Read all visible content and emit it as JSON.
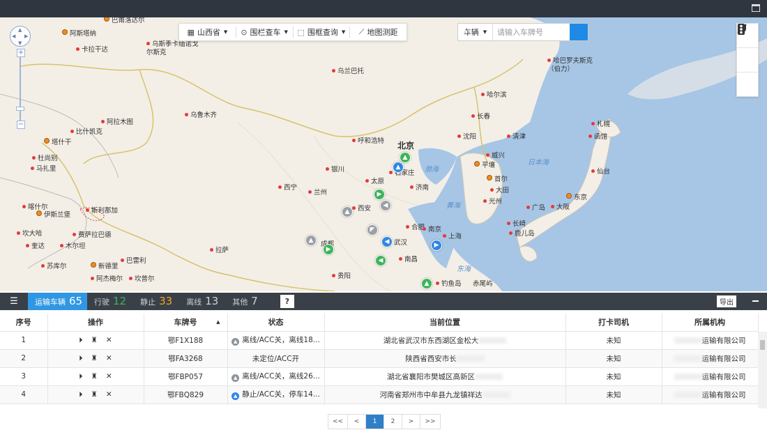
{
  "map": {
    "toolbar": {
      "region": "山西省",
      "fence_search": "围栏查车",
      "frame_search": "围框查询",
      "measure": "地图测距"
    },
    "search": {
      "type": "车辆",
      "placeholder": "请输入车牌号"
    },
    "labels": {
      "beijing": "北京",
      "hohhot": "呼和浩特",
      "shijiazhuang": "石家庄",
      "taiyuan": "太原",
      "jinan": "济南",
      "yinchuan": "银川",
      "xining": "西宁",
      "lanzhou": "兰州",
      "xian": "西安",
      "zhengzhou": "郑州",
      "hefei": "合肥",
      "nanjing": "南京",
      "shanghai": "上海",
      "hangzhou": "杭州",
      "wuhan": "武汉",
      "changsha": "长沙",
      "nanchang": "南昌",
      "chengdu": "成都",
      "chongqing": "重庆",
      "guiyang": "贵阳",
      "lhasa": "拉萨",
      "fuzhou": "福州",
      "shenyang": "沈阳",
      "changchun": "长春",
      "harbin": "哈尔滨",
      "urumqi": "乌鲁木齐",
      "ulaanbaatar": "乌兰巴托",
      "tianjin": "清津",
      "weihai": "威兴",
      "pyongyang": "平壤",
      "seoul": "首尔",
      "daejeon": "大田",
      "gwangju": "光州",
      "hiroshima": "广岛",
      "osaka": "大阪",
      "tokyo": "东京",
      "sendai": "仙台",
      "hakodate": "函馆",
      "sapporo": "札幌",
      "nagasaki": "长崎",
      "kagoshima": "鹿儿岛",
      "khabarovsk": "哈巴罗夫斯克（伯力）",
      "astana": "阿斯塔纳",
      "karaganda": "卡拉干达",
      "ust_kamenogorsk": "乌斯季卡缅诺戈尔斯克",
      "almaty": "阿拉木图",
      "bishkek": "比什凯克",
      "tashkent": "塔什干",
      "dushanbe": "杜尚别",
      "mazar": "马扎里",
      "kashgar": "喀什尔",
      "islamabad": "伊斯兰堡",
      "srinagar": "斯利那加",
      "kandahar": "坎大哈",
      "quetta": "奎达",
      "faisalabad": "费萨拉巴德",
      "multan": "木尔坦",
      "lucknow": "苏库尔",
      "delhi": "新德里",
      "jaipur": "巴雷利",
      "kanpur": "阿杰梅尔",
      "kathmandu": "坎普尔",
      "pavlodar": "巴甫洛达尔",
      "bohai": "渤海",
      "yellow_sea": "黄海",
      "east_sea": "东海",
      "japan_sea": "日本海",
      "diaoyu": "钓鱼岛",
      "chiwei": "赤尾屿"
    }
  },
  "stats": {
    "transport_label": "运输车辆",
    "transport_count": "65",
    "moving_label": "行驶",
    "moving_count": "12",
    "stopped_label": "静止",
    "stopped_count": "33",
    "offline_label": "离线",
    "offline_count": "13",
    "other_label": "其他",
    "other_count": "7",
    "help": "?",
    "export": "导出"
  },
  "colors": {
    "moving": "#3cb55a",
    "stopped": "#f5a623",
    "offline": "#cfd3d8",
    "other": "#cfd3d8",
    "accent": "#2f97e3"
  },
  "table": {
    "headers": [
      "序号",
      "操作",
      "车牌号",
      "状态",
      "当前位置",
      "打卡司机",
      "所属机构"
    ],
    "rows": [
      {
        "no": "1",
        "plate": "鄂F1X188",
        "status": "离线/ACC关，离线18...",
        "status_icon": "gray",
        "location": "湖北省武汉市东西湖区金松大",
        "driver": "未知",
        "org": "运输有限公司"
      },
      {
        "no": "2",
        "plate": "鄂FA3268",
        "status": "未定位/ACC开",
        "status_icon": "",
        "location": "陕西省西安市长",
        "driver": "未知",
        "org": "运输有限公司"
      },
      {
        "no": "3",
        "plate": "鄂FBP057",
        "status": "离线/ACC关，离线26...",
        "status_icon": "gray",
        "location": "湖北省襄阳市樊城区高新区",
        "driver": "未知",
        "org": "运输有限公司"
      },
      {
        "no": "4",
        "plate": "鄂FBQ829",
        "status": "静止/ACC关，停车14...",
        "status_icon": "blue",
        "location": "河南省郑州市中牟县九龙镇祥达",
        "driver": "未知",
        "org": "运输有限公司"
      }
    ]
  },
  "pager": {
    "first": "<<",
    "prev": "<",
    "pages": [
      "1",
      "2"
    ],
    "next": ">",
    "last": ">>"
  }
}
